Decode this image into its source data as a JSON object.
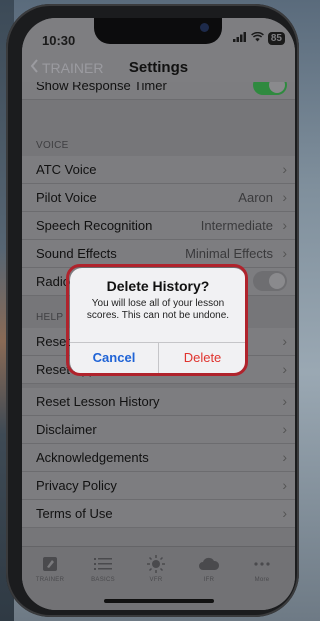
{
  "status": {
    "time": "10:30",
    "signal": "ıll",
    "wifi": "wifi",
    "battery": "85"
  },
  "nav": {
    "back_label": "TRAINER",
    "title": "Settings"
  },
  "rows_top": {
    "show_response_timer": "Show Response Timer"
  },
  "sections": {
    "voice": "VOICE",
    "help": "HELP"
  },
  "voice_rows": [
    {
      "label": "ATC Voice",
      "value": ""
    },
    {
      "label": "Pilot Voice",
      "value": "Aaron"
    },
    {
      "label": "Speech Recognition",
      "value": "Intermediate"
    },
    {
      "label": "Sound Effects",
      "value": "Minimal Effects"
    },
    {
      "label": "Radio Chatter",
      "value": ""
    }
  ],
  "help_rows": [
    {
      "label": "Reset Warnings"
    },
    {
      "label": "Reset App Tutorials"
    },
    {
      "label": "Reset Lesson History"
    },
    {
      "label": "Disclaimer"
    },
    {
      "label": "Acknowledgements"
    },
    {
      "label": "Privacy Policy"
    },
    {
      "label": "Terms of Use"
    }
  ],
  "dialog": {
    "title": "Delete History?",
    "message": "You will lose all of your lesson scores. This can not be undone.",
    "cancel": "Cancel",
    "delete": "Delete"
  },
  "tabs": [
    {
      "label": "TRAINER",
      "icon": "pencil-square-icon"
    },
    {
      "label": "BASICS",
      "icon": "list-icon"
    },
    {
      "label": "VFR",
      "icon": "sun-icon"
    },
    {
      "label": "IFR",
      "icon": "cloud-icon"
    },
    {
      "label": "More",
      "icon": "more-dots-icon"
    }
  ],
  "colors": {
    "accent": "#1f63d6",
    "destructive": "#e0332e",
    "toggle_on": "#2f8a3f",
    "highlight": "#b0232c"
  }
}
